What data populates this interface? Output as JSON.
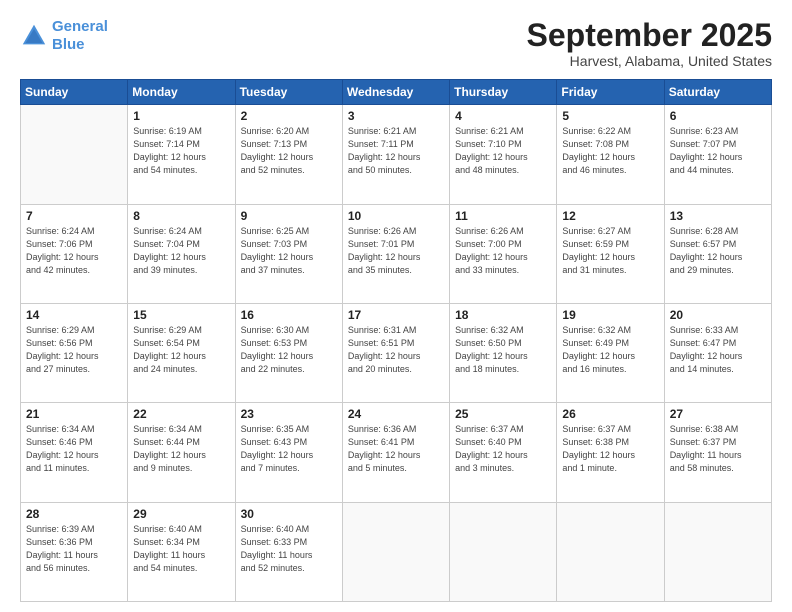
{
  "header": {
    "logo_line1": "General",
    "logo_line2": "Blue",
    "month": "September 2025",
    "location": "Harvest, Alabama, United States"
  },
  "weekdays": [
    "Sunday",
    "Monday",
    "Tuesday",
    "Wednesday",
    "Thursday",
    "Friday",
    "Saturday"
  ],
  "weeks": [
    [
      {
        "num": "",
        "info": ""
      },
      {
        "num": "1",
        "info": "Sunrise: 6:19 AM\nSunset: 7:14 PM\nDaylight: 12 hours\nand 54 minutes."
      },
      {
        "num": "2",
        "info": "Sunrise: 6:20 AM\nSunset: 7:13 PM\nDaylight: 12 hours\nand 52 minutes."
      },
      {
        "num": "3",
        "info": "Sunrise: 6:21 AM\nSunset: 7:11 PM\nDaylight: 12 hours\nand 50 minutes."
      },
      {
        "num": "4",
        "info": "Sunrise: 6:21 AM\nSunset: 7:10 PM\nDaylight: 12 hours\nand 48 minutes."
      },
      {
        "num": "5",
        "info": "Sunrise: 6:22 AM\nSunset: 7:08 PM\nDaylight: 12 hours\nand 46 minutes."
      },
      {
        "num": "6",
        "info": "Sunrise: 6:23 AM\nSunset: 7:07 PM\nDaylight: 12 hours\nand 44 minutes."
      }
    ],
    [
      {
        "num": "7",
        "info": "Sunrise: 6:24 AM\nSunset: 7:06 PM\nDaylight: 12 hours\nand 42 minutes."
      },
      {
        "num": "8",
        "info": "Sunrise: 6:24 AM\nSunset: 7:04 PM\nDaylight: 12 hours\nand 39 minutes."
      },
      {
        "num": "9",
        "info": "Sunrise: 6:25 AM\nSunset: 7:03 PM\nDaylight: 12 hours\nand 37 minutes."
      },
      {
        "num": "10",
        "info": "Sunrise: 6:26 AM\nSunset: 7:01 PM\nDaylight: 12 hours\nand 35 minutes."
      },
      {
        "num": "11",
        "info": "Sunrise: 6:26 AM\nSunset: 7:00 PM\nDaylight: 12 hours\nand 33 minutes."
      },
      {
        "num": "12",
        "info": "Sunrise: 6:27 AM\nSunset: 6:59 PM\nDaylight: 12 hours\nand 31 minutes."
      },
      {
        "num": "13",
        "info": "Sunrise: 6:28 AM\nSunset: 6:57 PM\nDaylight: 12 hours\nand 29 minutes."
      }
    ],
    [
      {
        "num": "14",
        "info": "Sunrise: 6:29 AM\nSunset: 6:56 PM\nDaylight: 12 hours\nand 27 minutes."
      },
      {
        "num": "15",
        "info": "Sunrise: 6:29 AM\nSunset: 6:54 PM\nDaylight: 12 hours\nand 24 minutes."
      },
      {
        "num": "16",
        "info": "Sunrise: 6:30 AM\nSunset: 6:53 PM\nDaylight: 12 hours\nand 22 minutes."
      },
      {
        "num": "17",
        "info": "Sunrise: 6:31 AM\nSunset: 6:51 PM\nDaylight: 12 hours\nand 20 minutes."
      },
      {
        "num": "18",
        "info": "Sunrise: 6:32 AM\nSunset: 6:50 PM\nDaylight: 12 hours\nand 18 minutes."
      },
      {
        "num": "19",
        "info": "Sunrise: 6:32 AM\nSunset: 6:49 PM\nDaylight: 12 hours\nand 16 minutes."
      },
      {
        "num": "20",
        "info": "Sunrise: 6:33 AM\nSunset: 6:47 PM\nDaylight: 12 hours\nand 14 minutes."
      }
    ],
    [
      {
        "num": "21",
        "info": "Sunrise: 6:34 AM\nSunset: 6:46 PM\nDaylight: 12 hours\nand 11 minutes."
      },
      {
        "num": "22",
        "info": "Sunrise: 6:34 AM\nSunset: 6:44 PM\nDaylight: 12 hours\nand 9 minutes."
      },
      {
        "num": "23",
        "info": "Sunrise: 6:35 AM\nSunset: 6:43 PM\nDaylight: 12 hours\nand 7 minutes."
      },
      {
        "num": "24",
        "info": "Sunrise: 6:36 AM\nSunset: 6:41 PM\nDaylight: 12 hours\nand 5 minutes."
      },
      {
        "num": "25",
        "info": "Sunrise: 6:37 AM\nSunset: 6:40 PM\nDaylight: 12 hours\nand 3 minutes."
      },
      {
        "num": "26",
        "info": "Sunrise: 6:37 AM\nSunset: 6:38 PM\nDaylight: 12 hours\nand 1 minute."
      },
      {
        "num": "27",
        "info": "Sunrise: 6:38 AM\nSunset: 6:37 PM\nDaylight: 11 hours\nand 58 minutes."
      }
    ],
    [
      {
        "num": "28",
        "info": "Sunrise: 6:39 AM\nSunset: 6:36 PM\nDaylight: 11 hours\nand 56 minutes."
      },
      {
        "num": "29",
        "info": "Sunrise: 6:40 AM\nSunset: 6:34 PM\nDaylight: 11 hours\nand 54 minutes."
      },
      {
        "num": "30",
        "info": "Sunrise: 6:40 AM\nSunset: 6:33 PM\nDaylight: 11 hours\nand 52 minutes."
      },
      {
        "num": "",
        "info": ""
      },
      {
        "num": "",
        "info": ""
      },
      {
        "num": "",
        "info": ""
      },
      {
        "num": "",
        "info": ""
      }
    ]
  ]
}
